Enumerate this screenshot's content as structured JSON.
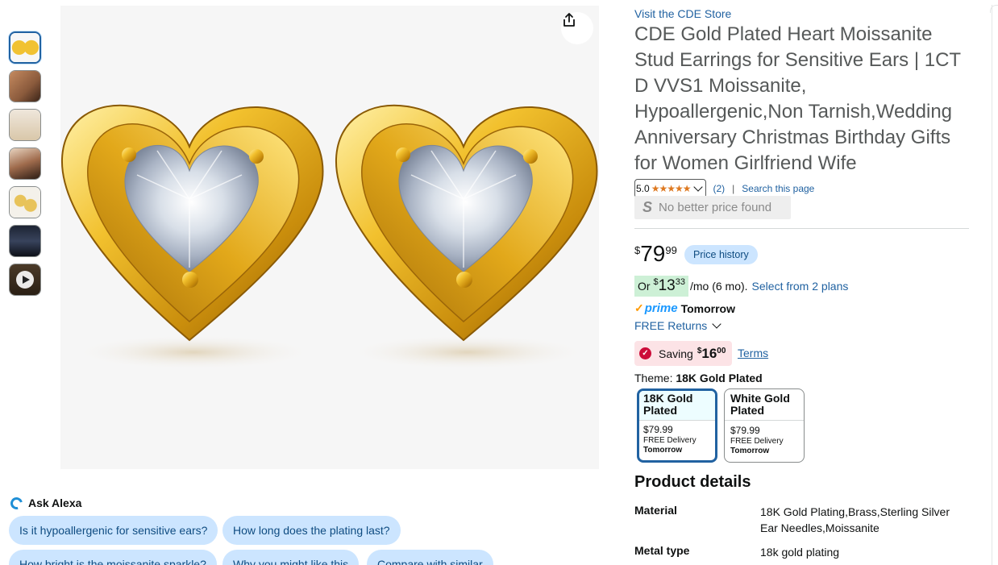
{
  "thumbnails": [
    "earrings-pair",
    "model-ear",
    "gift-box",
    "model-portrait",
    "pair-angled",
    "promo-dark",
    "video"
  ],
  "store_link": "Visit the CDE Store",
  "product_title": "CDE Gold Plated Heart Moissanite Stud Earrings for Sensitive Ears | 1CT D VVS1 Moissanite, Hypoallergenic,Non Tarnish,Wedding Anniversary Christmas Birthday Gifts for Women Girlfriend Wife",
  "rating": {
    "value": "5.0",
    "stars": "★★★★★",
    "count": "(2)",
    "separator": "|",
    "search_link": "Search this page"
  },
  "no_better_price": {
    "icon_text": "S",
    "text": "No better price found"
  },
  "price": {
    "currency": "$",
    "whole": "79",
    "fraction": "99",
    "history_button": "Price history"
  },
  "monthly": {
    "prefix": "Or",
    "currency": "$",
    "whole": "13",
    "fraction": "33",
    "suffix": "/mo (6 mo).",
    "plans_link": "Select from 2 plans"
  },
  "delivery": {
    "check": "✓",
    "prime_label": "prime",
    "day": "Tomorrow",
    "returns": "FREE Returns"
  },
  "saving": {
    "label": "Saving",
    "currency": "$",
    "whole": "16",
    "fraction": "00",
    "terms": "Terms"
  },
  "theme": {
    "label": "Theme:",
    "selected": "18K Gold Plated",
    "options": [
      {
        "name": "18K Gold Plated",
        "price": "$79.99",
        "delivery": "FREE Delivery",
        "day": "Tomorrow"
      },
      {
        "name": "White Gold Plated",
        "price": "$79.99",
        "delivery": "FREE Delivery",
        "day": "Tomorrow"
      }
    ]
  },
  "product_details": {
    "title": "Product details",
    "rows": [
      {
        "key": "Material",
        "value": "18K Gold Plating,Brass,Sterling Silver Ear Needles,Moissanite"
      },
      {
        "key": "Metal type",
        "value": "18k gold plating"
      }
    ]
  },
  "ask_alexa": {
    "title": "Ask Alexa",
    "questions": [
      "Is it hypoallergenic for sensitive ears?",
      "How long does the plating last?",
      "How bright is the moissanite sparkle?",
      "Why you might like this",
      "Compare with similar"
    ]
  },
  "colors": {
    "link": "#2162a1",
    "star": "#de7921",
    "chip_bg": "#cce5ff",
    "saving_bg": "#fce3e6",
    "monthly_bg": "#cdf0d6",
    "prime": "#1a98ff"
  },
  "icons": [
    "share-icon",
    "chevron-down-icon",
    "alexa-icon",
    "play-icon",
    "check-circle-icon"
  ]
}
